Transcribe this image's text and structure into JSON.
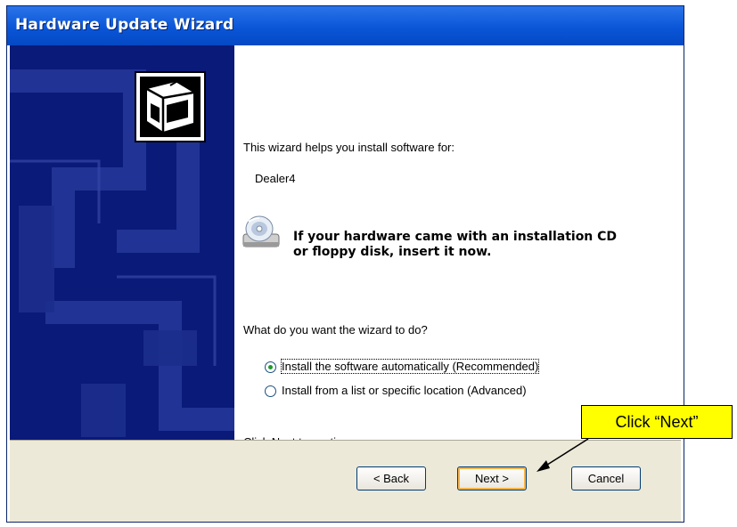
{
  "window": {
    "title": "Hardware Update Wizard"
  },
  "content": {
    "intro": "This wizard helps you install software for:",
    "device_name": "Dealer4",
    "cd_prompt_line1": "If your hardware came with an installation CD",
    "cd_prompt_line2": "or floppy disk, insert it now.",
    "question": "What do you want the wizard to do?",
    "options": [
      {
        "label": "Install the software automatically (Recommended)",
        "selected": true
      },
      {
        "label": "Install from a list or specific location (Advanced)",
        "selected": false
      }
    ],
    "continue_hint": "Click Next to continue."
  },
  "buttons": {
    "back": "< Back",
    "next": "Next >",
    "cancel": "Cancel"
  },
  "annotation": {
    "callout": "Click “Next”"
  },
  "colors": {
    "titlebar": "#0a56d8",
    "sidebar": "#0a1a78",
    "buttonbar": "#ece9d8",
    "callout": "#ffff00"
  }
}
